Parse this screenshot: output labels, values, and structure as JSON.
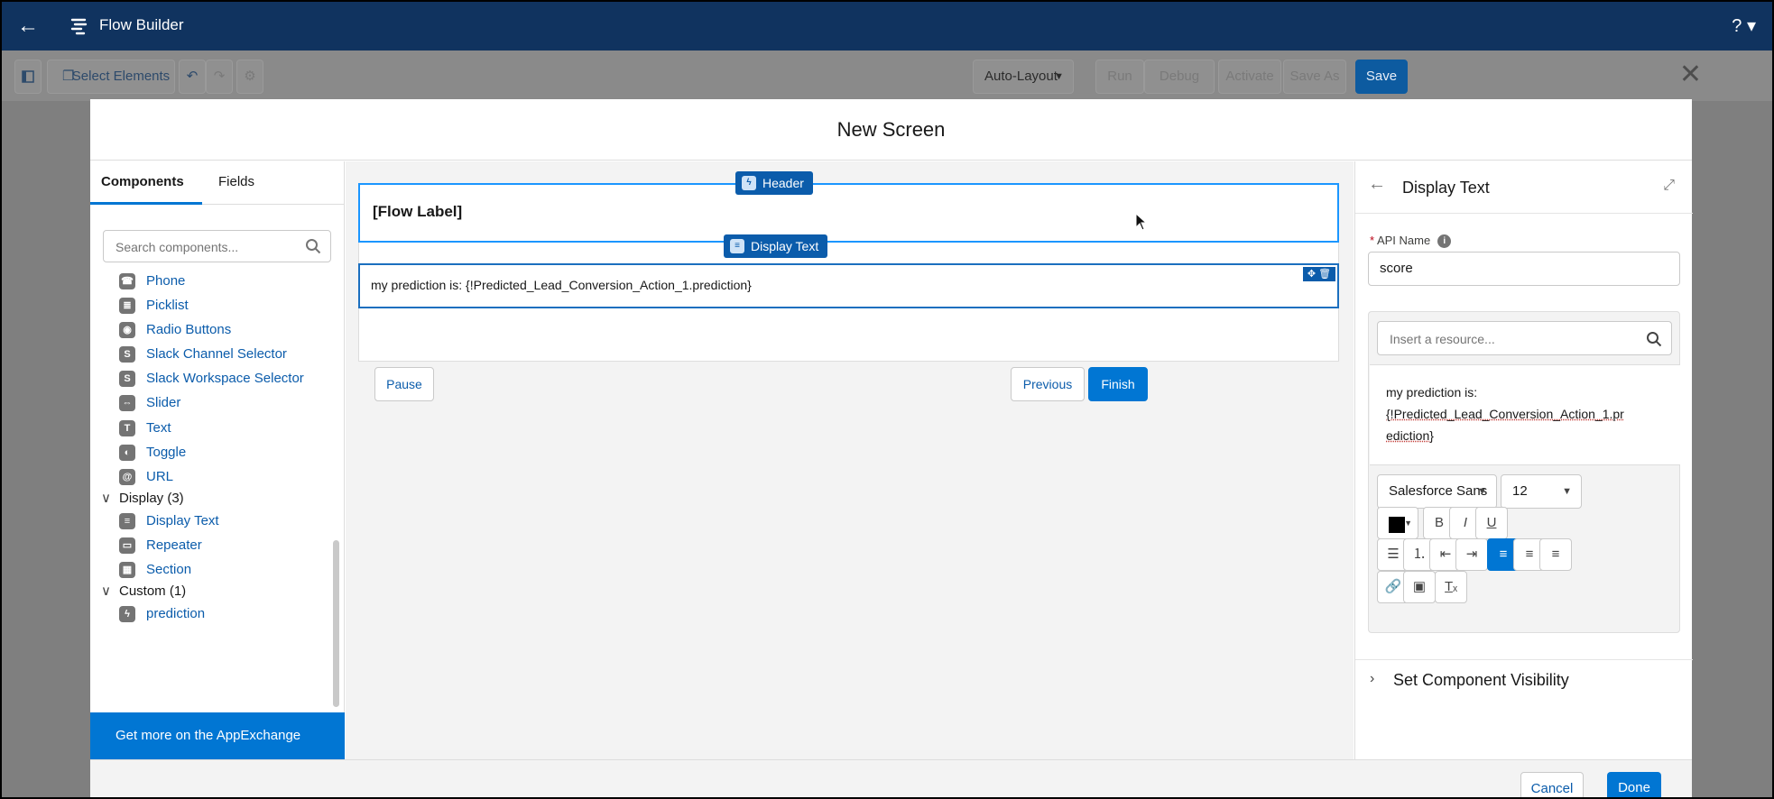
{
  "app": {
    "title": "Flow Builder",
    "help": "?"
  },
  "toolbar": {
    "select_elements": "Select Elements",
    "layout": "Auto-Layout",
    "run": "Run",
    "debug": "Debug",
    "activate": "Activate",
    "save_as": "Save As",
    "save": "Save"
  },
  "modal": {
    "title": "New Screen",
    "cancel": "Cancel",
    "done": "Done"
  },
  "palette": {
    "tabs": [
      "Components",
      "Fields"
    ],
    "search_placeholder": "Search components...",
    "items": [
      {
        "label": "Phone",
        "icon": "phone-icon",
        "glyph": "☎"
      },
      {
        "label": "Picklist",
        "icon": "picklist-icon",
        "glyph": "≣"
      },
      {
        "label": "Radio Buttons",
        "icon": "radio-icon",
        "glyph": "◉"
      },
      {
        "label": "Slack Channel Selector",
        "icon": "slack-icon",
        "glyph": "S"
      },
      {
        "label": "Slack Workspace Selector",
        "icon": "slack-icon",
        "glyph": "S"
      },
      {
        "label": "Slider",
        "icon": "slider-icon",
        "glyph": "⇔"
      },
      {
        "label": "Text",
        "icon": "text-icon",
        "glyph": "T"
      },
      {
        "label": "Toggle",
        "icon": "toggle-icon",
        "glyph": "◐"
      },
      {
        "label": "URL",
        "icon": "url-icon",
        "glyph": "@"
      }
    ],
    "display_section": "Display (3)",
    "display_items": [
      {
        "label": "Display Text",
        "icon": "display-text-icon",
        "glyph": "≡"
      },
      {
        "label": "Repeater",
        "icon": "repeater-icon",
        "glyph": "▭"
      },
      {
        "label": "Section",
        "icon": "section-icon",
        "glyph": "▦"
      }
    ],
    "custom_section": "Custom (1)",
    "custom_items": [
      {
        "label": "prediction",
        "icon": "lightning-icon",
        "glyph": "ϟ"
      }
    ],
    "appexchange": "Get more on the AppExchange"
  },
  "canvas": {
    "header_tag": "Header",
    "flow_label": "[Flow Label]",
    "display_text_tag": "Display Text",
    "display_text": "my prediction is: {!Predicted_Lead_Conversion_Action_1.prediction}",
    "pause": "Pause",
    "previous": "Previous",
    "finish": "Finish"
  },
  "properties": {
    "title": "Display Text",
    "api_label": "API Name",
    "api_value": "score",
    "resource_placeholder": "Insert a resource...",
    "text_line1": "my prediction is:",
    "text_line2": "{!Predicted_Lead_Conversion_Action_1.pr",
    "text_line3": "ediction}",
    "font_family": "Salesforce Sans",
    "font_size": "12",
    "text_color": "#000000",
    "visibility": "Set Component Visibility"
  },
  "colors": {
    "brand": "#0176d3",
    "appbar": "#10335f",
    "selection": "#1b96ff"
  }
}
